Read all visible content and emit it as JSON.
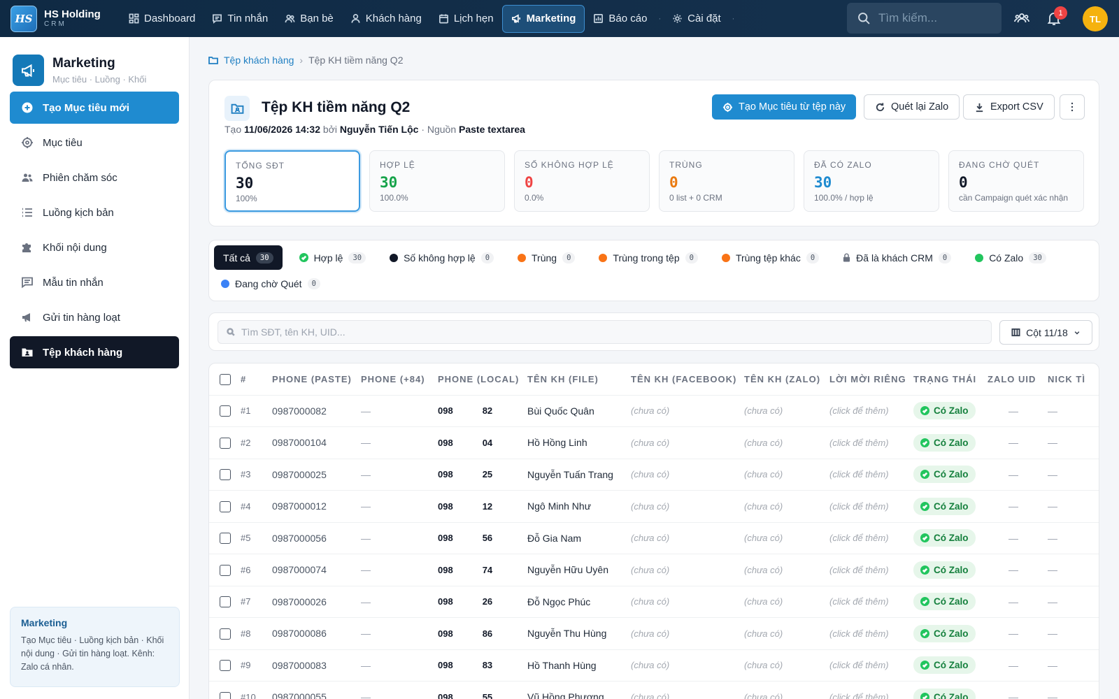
{
  "brand": {
    "logo": "HS",
    "name": "HS Holding",
    "sub": "CRM"
  },
  "nav": [
    {
      "label": "Dashboard",
      "icon": "dashboard-icon"
    },
    {
      "label": "Tin nhắn",
      "icon": "message-icon"
    },
    {
      "label": "Bạn bè",
      "icon": "friends-icon"
    },
    {
      "label": "Khách hàng",
      "icon": "customer-icon"
    },
    {
      "label": "Lịch hẹn",
      "icon": "calendar-icon"
    },
    {
      "label": "Marketing",
      "icon": "megaphone-icon",
      "active": true
    },
    {
      "label": "Báo cáo",
      "icon": "report-icon"
    },
    {
      "label": "Cài đặt",
      "icon": "gear-icon"
    }
  ],
  "topbar": {
    "search_placeholder": "Tìm kiếm...",
    "notif_count": "1",
    "avatar": "TL"
  },
  "sidebar": {
    "title": "Marketing",
    "subtitle": "Mục tiêu · Luồng · Khối",
    "items": [
      {
        "label": "Tạo Mục tiêu mới",
        "icon": "plus-circle-icon"
      },
      {
        "label": "Mục tiêu",
        "icon": "target-icon"
      },
      {
        "label": "Phiên chăm sóc",
        "icon": "users-icon"
      },
      {
        "label": "Luồng kịch bản",
        "icon": "list-icon"
      },
      {
        "label": "Khối nội dung",
        "icon": "puzzle-icon"
      },
      {
        "label": "Mẫu tin nhắn",
        "icon": "message-template-icon"
      },
      {
        "label": "Gửi tin hàng loạt",
        "icon": "broadcast-icon"
      },
      {
        "label": "Tệp khách hàng",
        "icon": "folder-user-icon"
      }
    ],
    "info_title": "Marketing",
    "info_text": "Tạo Mục tiêu · Luồng kịch bản · Khối nội dung · Gửi tin hàng loạt. Kênh: Zalo cá nhân."
  },
  "breadcrumb": {
    "parent": "Tệp khách hàng",
    "current": "Tệp KH tiềm năng Q2"
  },
  "header": {
    "title": "Tệp KH tiềm năng Q2",
    "meta_created_label": "Tạo",
    "created": "11/06/2026 14:32",
    "meta_by_label": "bởi",
    "author": "Nguyễn Tiến Lộc",
    "meta_source_label": "· Nguồn",
    "source": "Paste textarea",
    "btn_create": "Tạo Mục tiêu từ tệp này",
    "btn_rescan": "Quét lại Zalo",
    "btn_export": "Export CSV"
  },
  "stats": [
    {
      "label": "TỔNG SĐT",
      "value": "30",
      "sub": "100%",
      "color": "#111827"
    },
    {
      "label": "HỢP LỆ",
      "value": "30",
      "sub": "100.0%",
      "color": "#16a34a"
    },
    {
      "label": "SỐ KHÔNG HỢP LỆ",
      "value": "0",
      "sub": "0.0%",
      "color": "#ef4444"
    },
    {
      "label": "TRÙNG",
      "value": "0",
      "sub": "0 list + 0 CRM",
      "color": "#ea7a10"
    },
    {
      "label": "ĐÃ CÓ ZALO",
      "value": "30",
      "sub": "100.0% / hợp lệ",
      "color": "#1f8bd0"
    },
    {
      "label": "ĐANG CHỜ QUÉT",
      "value": "0",
      "sub": "cần Campaign quét xác nhận",
      "color": "#111827"
    }
  ],
  "filters": [
    {
      "label": "Tất cả",
      "count": "30",
      "marker": "none"
    },
    {
      "label": "Hợp lệ",
      "count": "30",
      "marker": "check"
    },
    {
      "label": "Số không hợp lệ",
      "count": "0",
      "marker": "#111827"
    },
    {
      "label": "Trùng",
      "count": "0",
      "marker": "#f97316"
    },
    {
      "label": "Trùng trong tệp",
      "count": "0",
      "marker": "#f97316"
    },
    {
      "label": "Trùng tệp khác",
      "count": "0",
      "marker": "#f97316"
    },
    {
      "label": "Đã là khách CRM",
      "count": "0",
      "marker": "lock"
    },
    {
      "label": "Có Zalo",
      "count": "30",
      "marker": "#22c55e"
    },
    {
      "label": "Đang chờ Quét",
      "count": "0",
      "marker": "#3b82f6"
    }
  ],
  "table_search_placeholder": "Tìm SĐT, tên KH, UID...",
  "columns_button": "Cột 11/18",
  "columns": [
    "#",
    "PHONE (PASTE)",
    "PHONE (+84)",
    "PHONE (LOCAL)",
    "TÊN KH (FILE)",
    "TÊN KH (FACEBOOK)",
    "TÊN KH (ZALO)",
    "LỜI MỜI RIÊNG",
    "TRẠNG THÁI",
    "ZALO UID",
    "NICK TÌ"
  ],
  "empty_placeholder": "(chưa có)",
  "invite_placeholder": "(click để thêm)",
  "dash": "—",
  "rows": [
    {
      "idx": "#1",
      "paste": "0987000082",
      "local_a": "098",
      "local_b": "82",
      "name": "Bùi Quốc Quân",
      "status": "Có Zalo"
    },
    {
      "idx": "#2",
      "paste": "0987000104",
      "local_a": "098",
      "local_b": "04",
      "name": "Hồ Hồng Linh",
      "status": "Có Zalo"
    },
    {
      "idx": "#3",
      "paste": "0987000025",
      "local_a": "098",
      "local_b": "25",
      "name": "Nguyễn Tuấn Trang",
      "status": "Có Zalo"
    },
    {
      "idx": "#4",
      "paste": "0987000012",
      "local_a": "098",
      "local_b": "12",
      "name": "Ngô Minh Như",
      "status": "Có Zalo"
    },
    {
      "idx": "#5",
      "paste": "0987000056",
      "local_a": "098",
      "local_b": "56",
      "name": "Đỗ Gia Nam",
      "status": "Có Zalo"
    },
    {
      "idx": "#6",
      "paste": "0987000074",
      "local_a": "098",
      "local_b": "74",
      "name": "Nguyễn Hữu Uyên",
      "status": "Có Zalo"
    },
    {
      "idx": "#7",
      "paste": "0987000026",
      "local_a": "098",
      "local_b": "26",
      "name": "Đỗ Ngọc Phúc",
      "status": "Có Zalo"
    },
    {
      "idx": "#8",
      "paste": "0987000086",
      "local_a": "098",
      "local_b": "86",
      "name": "Nguyễn Thu Hùng",
      "status": "Có Zalo"
    },
    {
      "idx": "#9",
      "paste": "0987000083",
      "local_a": "098",
      "local_b": "83",
      "name": "Hồ Thanh Hùng",
      "status": "Có Zalo"
    },
    {
      "idx": "#10",
      "paste": "0987000055",
      "local_a": "098",
      "local_b": "55",
      "name": "Vũ Hồng Phượng",
      "status": "Có Zalo"
    }
  ]
}
